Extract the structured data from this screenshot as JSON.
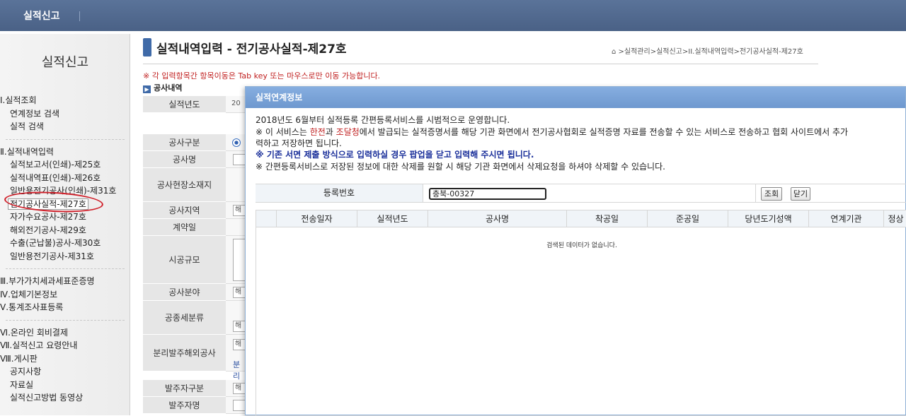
{
  "topbar": {
    "brand": "실적신고"
  },
  "sidebar": {
    "title": "실적신고",
    "menu": [
      {
        "label": "Ⅰ.실적조회",
        "level": 1
      },
      {
        "label": "연계정보 검색",
        "level": 2
      },
      {
        "label": "실적 검색",
        "level": 2
      },
      {
        "label": "Ⅱ.실적내역입력",
        "level": 1
      },
      {
        "label": "실적보고서(인쇄)-제25호",
        "level": 2
      },
      {
        "label": "실적내역표(인쇄)-제26호",
        "level": 2
      },
      {
        "label": "일반용전기공사(인쇄)-제31호",
        "level": 2
      },
      {
        "label": "전기공사실적-제27호",
        "level": 2,
        "active": true
      },
      {
        "label": "자가수요공사-제27호",
        "level": 2
      },
      {
        "label": "해외전기공사-제29호",
        "level": 2
      },
      {
        "label": "수출(군납불)공사-제30호",
        "level": 2
      },
      {
        "label": "일반용전기공사-제31호",
        "level": 2
      },
      {
        "label": "Ⅲ.부가가치세과세표준증명",
        "level": 1
      },
      {
        "label": "Ⅳ.업체기본정보",
        "level": 1
      },
      {
        "label": "Ⅴ.통계조사표등록",
        "level": 1
      },
      {
        "label": "Ⅵ.온라인 회비결제",
        "level": 1
      },
      {
        "label": "Ⅶ.실적신고 요령안내",
        "level": 1
      },
      {
        "label": "Ⅷ.게시판",
        "level": 1
      },
      {
        "label": "공지사항",
        "level": 2
      },
      {
        "label": "자료실",
        "level": 2
      },
      {
        "label": "실적신고방법 동영상",
        "level": 2
      }
    ]
  },
  "main": {
    "title": "실적내역입력 - 전기공사실적-제27호",
    "breadcrumb": "⌂ >실적관리>실적신고>II.실적내역입력>전기공사실적-제27호",
    "notice": "※ 각 입력항목간 항목이동은 Tab key 또는 마우스로만 이동 가능합니다.",
    "section": "공사내역",
    "form_labels": {
      "year": "실적년도",
      "type": "공사구분",
      "name": "공사명",
      "location": "공사현장소재지",
      "region": "공사지역",
      "contract": "계약일",
      "scale": "시공규모",
      "field": "공사분야",
      "category": "공종세분류",
      "split": "분리발주해외공사",
      "client_type": "발주자구분",
      "client": "발주자명"
    },
    "form_values": {
      "year": "20",
      "region": "해",
      "field": "해",
      "category": "해",
      "split1": "해",
      "split2": "분리",
      "client_type": "해"
    }
  },
  "modal": {
    "title": "실적연계정보",
    "line1": "2018년도 6월부터 실적등록 간편등록서비스를 시범적으로 운영합니다.",
    "line2_a": "※ 이 서비스는 ",
    "line2_red1": "한전",
    "line2_b": "과 ",
    "line2_red2": "조달청",
    "line2_c": "에서 발급되는 실적증명서를 해당 기관 화면에서 전기공사협회로 실적증명 자료를 전송할 수 있는 서비스로 전송하고 협회 사이트에서 추가",
    "line3": "력하고 저장하면 됩니다.",
    "line4": "※ 기존 서면 제출 방식으로 입력하실 경우 팝업을 닫고 입력해 주시면 됩니다.",
    "line5": "※ 간편등록서비스로 저장된 정보에 대한 삭제를 원할 시 해당 기관 화면에서 삭제요청을 하셔야 삭제할 수 있습니다.",
    "reg_label": "등록번호",
    "reg_value": "충북-00327",
    "search_btn": "조회",
    "close_btn": "닫기",
    "columns": [
      "",
      "전송일자",
      "실적년도",
      "공사명",
      "착공일",
      "준공일",
      "당년도기성액",
      "연계기관",
      "정상"
    ],
    "empty_text": "검색된 데이터가 없습니다."
  }
}
